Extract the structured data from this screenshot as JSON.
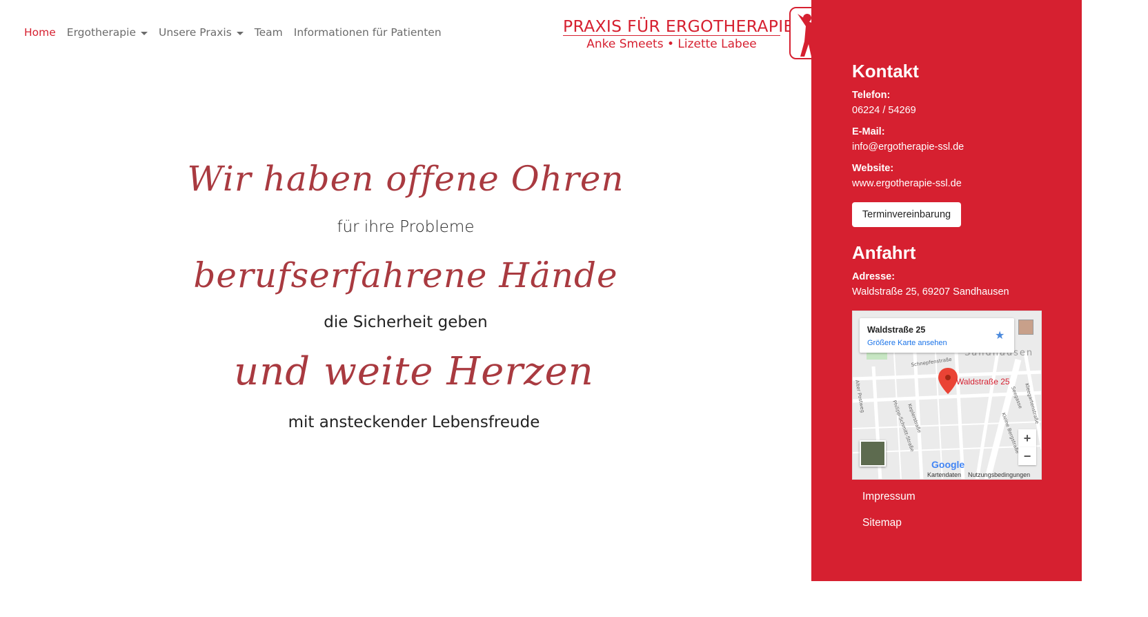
{
  "nav": {
    "items": [
      {
        "label": "Home",
        "active": true,
        "dropdown": false
      },
      {
        "label": "Ergotherapie",
        "active": false,
        "dropdown": true
      },
      {
        "label": "Unsere Praxis",
        "active": false,
        "dropdown": true
      },
      {
        "label": "Team",
        "active": false,
        "dropdown": false
      },
      {
        "label": "Informationen für Patienten",
        "active": false,
        "dropdown": false
      }
    ]
  },
  "logo": {
    "title": "PRAXIS FÜR ERGOTHERAPIE",
    "subtitle": "Anke Smeets • Lizette Labee"
  },
  "hero": {
    "line1_script": "Wir haben offene Ohren",
    "line1_text": "für ihre Probleme",
    "line2_script": "berufserfahrene Hände",
    "line2_text": "die Sicherheit geben",
    "line3_script": "und weite Herzen",
    "line3_text": "mit ansteckender Lebensfreude"
  },
  "sidebar": {
    "contact_heading": "Kontakt",
    "phone_label": "Telefon:",
    "phone_value": "06224 / 54269",
    "email_label": "E-Mail:",
    "email_value": "info@ergotherapie-ssl.de",
    "website_label": "Website:",
    "website_value": "www.ergotherapie-ssl.de",
    "appointment_button": "Terminvereinbarung",
    "directions_heading": "Anfahrt",
    "address_label": "Adresse:",
    "address_value": "Waldstraße 25, 69207 Sandhausen"
  },
  "map": {
    "place_title": "Waldstraße 25",
    "larger_map_link": "Größere Karte ansehen",
    "marker_label": "Waldstraße 25",
    "zoom_in": "+",
    "zoom_out": "−",
    "brand": "Google",
    "footer_data": "Kartendaten",
    "footer_terms": "Nutzungsbedingungen",
    "street_labels": [
      "Schnepfenstraße",
      "Kleine Bergstraße",
      "Seegasse",
      "Kleegartenstraße",
      "Philipp-Schmitt-Straße",
      "Keplerstraße",
      "Sandhausen",
      "Alter Postweg"
    ]
  },
  "footer": {
    "links": [
      "Impressum",
      "Sitemap"
    ]
  },
  "colors": {
    "accent": "#d62030",
    "script": "#a93a40",
    "nav_text": "#6b6b6b"
  }
}
